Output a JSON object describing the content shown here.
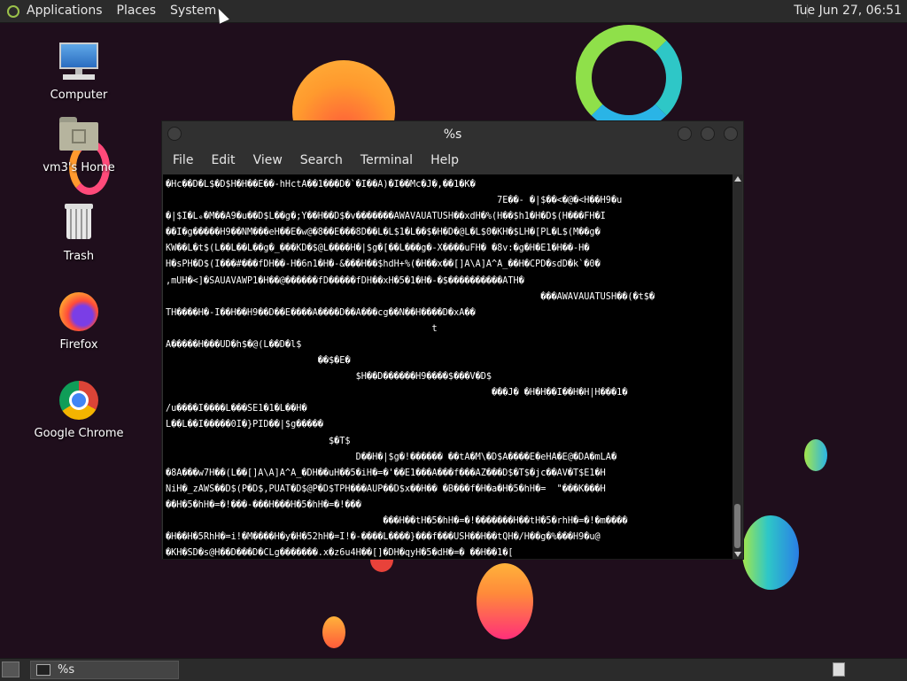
{
  "top_panel": {
    "menus": [
      "Applications",
      "Places",
      "System"
    ],
    "clock": "Tue Jun 27, 06:51"
  },
  "desktop": {
    "icons": [
      {
        "label": "Computer",
        "icon": "computer-icon"
      },
      {
        "label": "vm3's Home",
        "icon": "home-folder-icon"
      },
      {
        "label": "Trash",
        "icon": "trash-icon"
      },
      {
        "label": "Firefox",
        "icon": "firefox-icon"
      },
      {
        "label": "Google Chrome",
        "icon": "chrome-icon"
      }
    ]
  },
  "terminal": {
    "title": "%s",
    "menu": [
      "File",
      "Edit",
      "View",
      "Search",
      "Terminal",
      "Help"
    ],
    "output_lines": [
      "�Hc��D�L$�D$H�H��E��-hHctA��1���D�`�I��A)�I��Mc�J�,��1�K�",
      "                                                             7E��- �|$��<�@�<H��H9�u",
      "�|$I�Lₑ�M��A9�u��D$L��g�;Y��H��D$�v�������AWAVAUATUSH��xdH�%(H��$h1�H�D$(H���FH�I",
      "��I�g�����H9��NM���eH��E�w@�8��E���8D��L�L$1�L��$�H�D�@L�L$0�KH�$LH�[PL�L$(M��g�",
      "KW��L�t$(L��L��L��g�_���KD�$@L����H�|$g�[��L���g�-X����uFH� �8v:�g�H�E1�H��-H�",
      "H�sPH�D$(I���#���fDH��-H�6n1�H�-&���H��$hdH+%(�H��x��[]A\\A]A^A_��H�CPD�sdD�k`�0�",
      ",mUH�<]�SAUAVAWP1�H��@������fD�����fDH��xH�5�1�H�-�$����������ATH�",
      "                                                                     ���AWAVAUATUSH��(�t$�",
      "TH����H�-I��H��H9��D��E����A����D��A���cg��N��H����D�xA��",
      "                                                 t",
      "A�����H���UD�h$�@(L��D�l$",
      "                            ��$�E�",
      "                                   $H��D������H9����$���V�D$",
      "                                                            ���J� �H�H��I��H�H|H���1�",
      "/u����I����L���SE1�1�L��H�",
      "L��L��I�����0I�}PID��|$g�����",
      "                              $�T$",
      "                                   D��H�|$g�!������ ��tA�M\\�D$A����E�eHA�E@�DA�mLA�",
      "�8A���w7H��(L��[]A\\A]A^A_�DH��uH��5�iH�=�'��E1���A���f���AZ���D$�T$�jc��AV�T$E1�H",
      "NiH�_zAWS��D$(P�D$,PUAT�D$@P�D$TPH���AUP��D$x��H�� �B���f�H�a�H�5�hH�=  \"���K���H",
      "��H�5�hH�=�!���-���H���H�5�hH�=�!���",
      "                                        ���H��tH�5�hH�=�!�������H��tH�5�rhH�=�!�m����",
      "�H��H�5RhH�=i!�M����H�y�H�52hH�=I!�-����L����}���f���USH��H��tQH�/H��g�%���H9�u@",
      "�KH�SD�s@H��D���D�CLg�������.x�z6u4H��[]�DH�qyH�5�dH�=� ��H��1�["
    ]
  },
  "taskbar": {
    "task_label": "%s"
  },
  "colors": {
    "panel": "#2b2b2b",
    "desktop": "#1f0e1c",
    "terminal_bg": "#000000"
  }
}
